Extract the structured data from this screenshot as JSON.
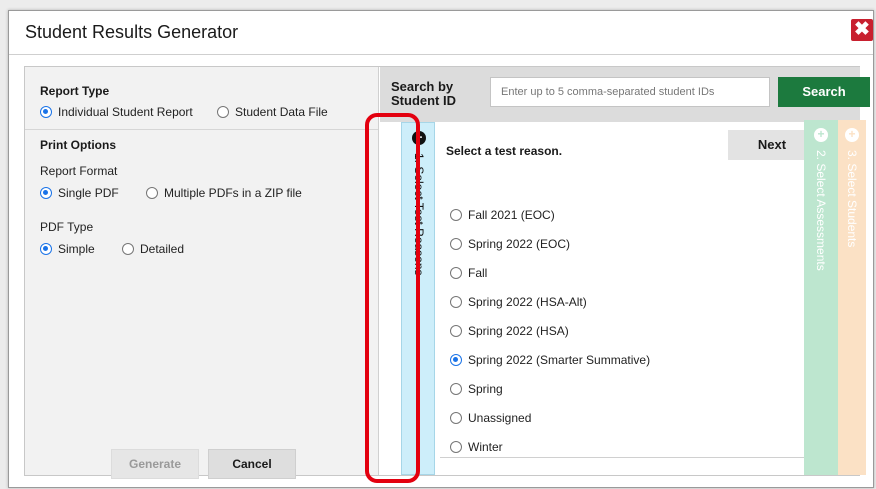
{
  "dialog": {
    "title": "Student Results Generator",
    "close_icon": "close-icon"
  },
  "left_panel": {
    "report_type": {
      "title": "Report Type",
      "options": [
        {
          "label": "Individual Student Report",
          "selected": true
        },
        {
          "label": "Student Data File",
          "selected": false
        }
      ]
    },
    "print_options": {
      "title": "Print Options",
      "report_format": {
        "label": "Report Format",
        "options": [
          {
            "label": "Single PDF",
            "selected": true
          },
          {
            "label": "Multiple PDFs in a ZIP file",
            "selected": false
          }
        ]
      },
      "pdf_type": {
        "label": "PDF Type",
        "options": [
          {
            "label": "Simple",
            "selected": true
          },
          {
            "label": "Detailed",
            "selected": false
          }
        ]
      }
    },
    "buttons": {
      "generate": "Generate",
      "cancel": "Cancel"
    }
  },
  "search": {
    "label_line1": "Search by",
    "label_line2": "Student ID",
    "placeholder": "Enter up to 5 comma-separated student IDs",
    "button": "Search"
  },
  "wizard": {
    "steps": [
      {
        "label": "1. Select Test Reasons",
        "icon": "minus-circle-icon",
        "active": true
      },
      {
        "label": "2. Select Assessments",
        "icon": "plus-circle-icon",
        "active": false
      },
      {
        "label": "3. Select Students",
        "icon": "plus-circle-icon",
        "active": false
      }
    ],
    "prompt": "Select a test reason.",
    "next": "Next",
    "reasons": [
      {
        "label": "Fall 2021 (EOC)",
        "selected": false
      },
      {
        "label": "Spring 2022 (EOC)",
        "selected": false
      },
      {
        "label": "Fall",
        "selected": false
      },
      {
        "label": "Spring 2022 (HSA-Alt)",
        "selected": false
      },
      {
        "label": "Spring 2022 (HSA)",
        "selected": false
      },
      {
        "label": "Spring 2022 (Smarter Summative)",
        "selected": true
      },
      {
        "label": "Spring",
        "selected": false
      },
      {
        "label": "Unassigned",
        "selected": false
      },
      {
        "label": "Winter",
        "selected": false
      }
    ]
  },
  "colors": {
    "accent_blue": "#1a73e8",
    "search_green": "#1c7a3e",
    "close_red": "#c8202f",
    "highlight_red": "#e3000f",
    "step1_bg": "#cdeefa",
    "step2_bg": "#bde6cf",
    "step3_bg": "#fbe1c5"
  }
}
